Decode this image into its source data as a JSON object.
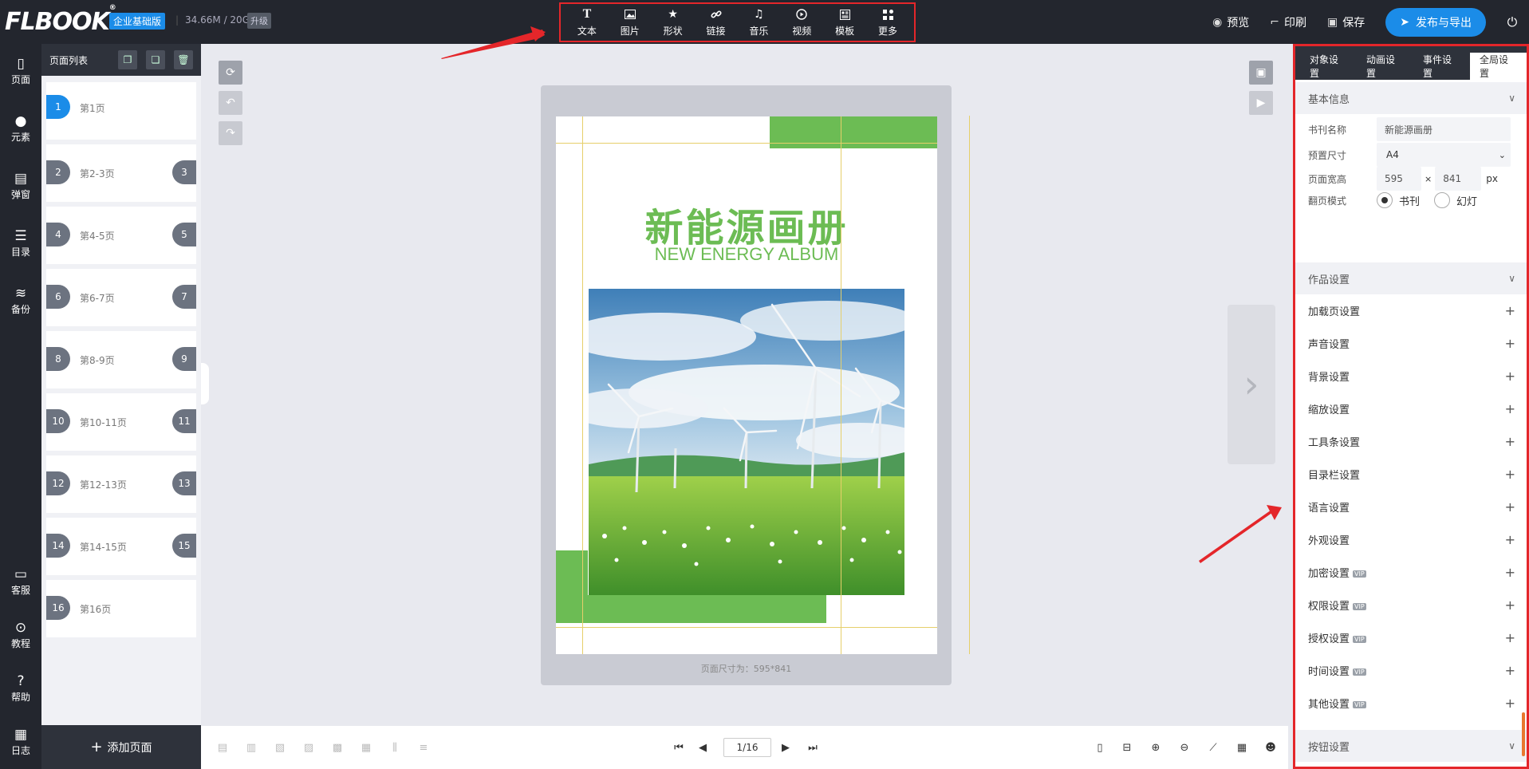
{
  "header": {
    "logo": "FLBOOK",
    "edition": "企业基础版",
    "storage": "34.66M / 20G",
    "upgrade": "升级",
    "tools": [
      {
        "icon": "text-icon",
        "label": "文本"
      },
      {
        "icon": "image-icon",
        "label": "图片"
      },
      {
        "icon": "star-icon",
        "label": "形状"
      },
      {
        "icon": "link-icon",
        "label": "链接"
      },
      {
        "icon": "music-icon",
        "label": "音乐"
      },
      {
        "icon": "video-icon",
        "label": "视频"
      },
      {
        "icon": "template-icon",
        "label": "模板"
      },
      {
        "icon": "more-icon",
        "label": "更多"
      }
    ],
    "preview": "预览",
    "print": "印刷",
    "save": "保存",
    "publish": "发布与导出"
  },
  "leftnav": {
    "items": [
      {
        "icon": "page-icon",
        "label": "页面"
      },
      {
        "icon": "elements-icon",
        "label": "元素"
      },
      {
        "icon": "popup-icon",
        "label": "弹窗"
      },
      {
        "icon": "toc-icon",
        "label": "目录"
      },
      {
        "icon": "layers-icon",
        "label": "备份"
      },
      {
        "icon": "chat-icon",
        "label": "客服"
      },
      {
        "icon": "play-icon",
        "label": "教程"
      },
      {
        "icon": "help-icon",
        "label": "帮助"
      },
      {
        "icon": "log-icon",
        "label": "日志"
      }
    ]
  },
  "pages": {
    "title": "页面列表",
    "items": [
      {
        "left": "1",
        "label": "第1页",
        "right": ""
      },
      {
        "left": "2",
        "label": "第2-3页",
        "right": "3"
      },
      {
        "left": "4",
        "label": "第4-5页",
        "right": "5"
      },
      {
        "left": "6",
        "label": "第6-7页",
        "right": "7"
      },
      {
        "left": "8",
        "label": "第8-9页",
        "right": "9"
      },
      {
        "left": "10",
        "label": "第10-11页",
        "right": "11"
      },
      {
        "left": "12",
        "label": "第12-13页",
        "right": "13"
      },
      {
        "left": "14",
        "label": "第14-15页",
        "right": "15"
      },
      {
        "left": "16",
        "label": "第16页",
        "right": ""
      }
    ],
    "add": "添加页面"
  },
  "canvas": {
    "title_cn": "新能源画册",
    "title_en": "NEW ENERGY ALBUM",
    "size_note": "页面尺寸为：595*841",
    "pager": "1/16"
  },
  "panel": {
    "tabs": [
      "对象设置",
      "动画设置",
      "事件设置",
      "全局设置"
    ],
    "basic_title": "基本信息",
    "book_name_label": "书刊名称",
    "book_name": "新能源画册",
    "preset_label": "预置尺寸",
    "preset": "A4",
    "size_label": "页面宽高",
    "width": "595",
    "times": "×",
    "height": "841",
    "unit": "px",
    "flip_label": "翻页模式",
    "flip_book": "书刊",
    "flip_slide": "幻灯",
    "work_title": "作品设置",
    "settings": [
      {
        "label": "加载页设置",
        "vip": ""
      },
      {
        "label": "声音设置",
        "vip": ""
      },
      {
        "label": "背景设置",
        "vip": ""
      },
      {
        "label": "缩放设置",
        "vip": ""
      },
      {
        "label": "工具条设置",
        "vip": ""
      },
      {
        "label": "目录栏设置",
        "vip": ""
      },
      {
        "label": "语言设置",
        "vip": ""
      },
      {
        "label": "外观设置",
        "vip": ""
      },
      {
        "label": "加密设置",
        "vip": "VIP"
      },
      {
        "label": "权限设置",
        "vip": "VIP"
      },
      {
        "label": "授权设置",
        "vip": "VIP"
      },
      {
        "label": "时间设置",
        "vip": "VIP"
      },
      {
        "label": "其他设置",
        "vip": "VIP"
      }
    ],
    "button_title": "按钮设置"
  },
  "colors": {
    "brand_green": "#6cbc54",
    "accent_blue": "#1b8ce8",
    "annotation_red": "#e4262a",
    "dark_chrome": "#23262e"
  }
}
